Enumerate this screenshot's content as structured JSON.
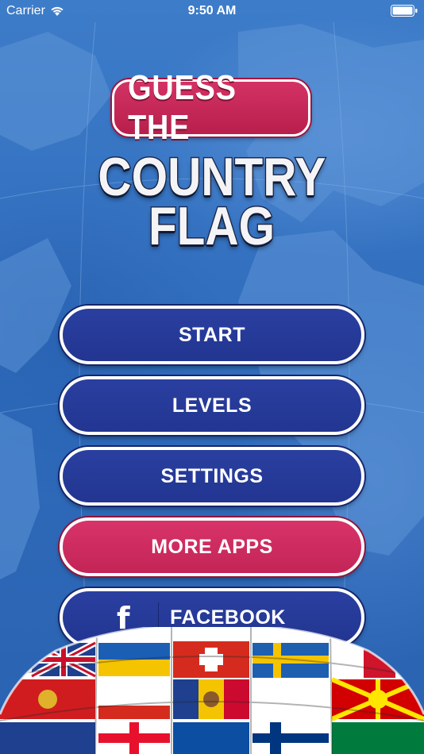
{
  "status_bar": {
    "carrier": "Carrier",
    "time": "9:50 AM"
  },
  "title": {
    "line1": "GUESS THE",
    "line2": "COUNTRY",
    "line3": "FLAG"
  },
  "menu": {
    "start": "START",
    "levels": "LEVELS",
    "settings": "SETTINGS",
    "more_apps": "MORE APPS",
    "facebook": "FACEBOOK",
    "facebook_icon": "f"
  },
  "colors": {
    "background": "#3a78c6",
    "button_blue": "#2a3fa0",
    "button_pink": "#d33264",
    "border": "#ffffff"
  },
  "icons": [
    "wifi-icon",
    "battery-icon",
    "facebook-icon"
  ]
}
